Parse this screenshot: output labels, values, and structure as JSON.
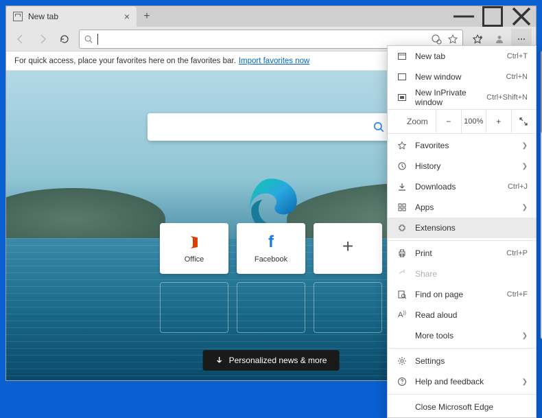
{
  "tab": {
    "title": "New tab"
  },
  "favorites_bar": {
    "message": "For quick access, place your favorites here on the favorites bar.",
    "link": "Import favorites now"
  },
  "tiles": {
    "office": "Office",
    "facebook": "Facebook"
  },
  "news_button": "Personalized news & more",
  "menu": {
    "new_tab": {
      "label": "New tab",
      "shortcut": "Ctrl+T"
    },
    "new_window": {
      "label": "New window",
      "shortcut": "Ctrl+N"
    },
    "new_inprivate": {
      "label": "New InPrivate window",
      "shortcut": "Ctrl+Shift+N"
    },
    "zoom": {
      "label": "Zoom",
      "value": "100%"
    },
    "favorites": {
      "label": "Favorites"
    },
    "history": {
      "label": "History"
    },
    "downloads": {
      "label": "Downloads",
      "shortcut": "Ctrl+J"
    },
    "apps": {
      "label": "Apps"
    },
    "extensions": {
      "label": "Extensions"
    },
    "print": {
      "label": "Print",
      "shortcut": "Ctrl+P"
    },
    "share": {
      "label": "Share"
    },
    "find": {
      "label": "Find on page",
      "shortcut": "Ctrl+F"
    },
    "read_aloud": {
      "label": "Read aloud"
    },
    "more_tools": {
      "label": "More tools"
    },
    "settings": {
      "label": "Settings"
    },
    "help": {
      "label": "Help and feedback"
    },
    "close": {
      "label": "Close Microsoft Edge"
    }
  }
}
